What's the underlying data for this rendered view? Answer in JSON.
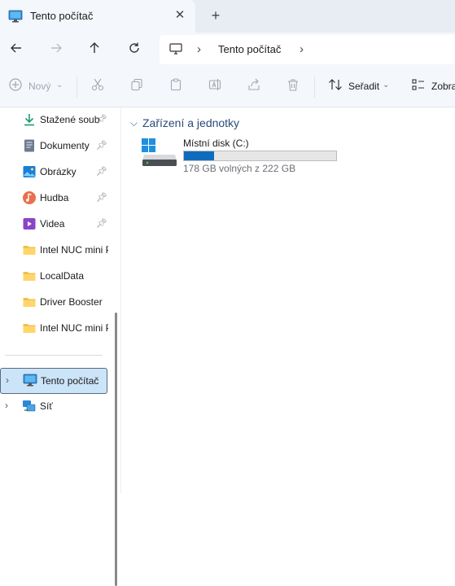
{
  "tab": {
    "title": "Tento počítač",
    "close_icon": "close-icon",
    "new_tab_icon": "plus-icon"
  },
  "address": {
    "crumb": "Tento počítač"
  },
  "toolbar": {
    "new_label": "Nový",
    "sort_label": "Seřadit",
    "view_label": "Zobra"
  },
  "sidebar": {
    "quick_access": [
      {
        "label": "Stažené soub",
        "icon": "download-icon",
        "pinned": true
      },
      {
        "label": "Dokumenty",
        "icon": "documents-icon",
        "pinned": true
      },
      {
        "label": "Obrázky",
        "icon": "pictures-icon",
        "pinned": true
      },
      {
        "label": "Hudba",
        "icon": "music-icon",
        "pinned": true
      },
      {
        "label": "Videa",
        "icon": "videos-icon",
        "pinned": true
      },
      {
        "label": "Intel NUC mini P",
        "icon": "folder-icon",
        "pinned": false
      },
      {
        "label": "LocalData",
        "icon": "folder-icon",
        "pinned": false
      },
      {
        "label": "Driver Booster",
        "icon": "folder-icon",
        "pinned": false
      },
      {
        "label": "Intel NUC mini P",
        "icon": "folder-icon",
        "pinned": false
      }
    ],
    "this_pc": "Tento počítač",
    "network": "Síť"
  },
  "main": {
    "group_title": "Zařízení a jednotky",
    "drive": {
      "name": "Místní disk (C:)",
      "size_text": "178 GB volných z 222 GB",
      "used_fraction": 0.198
    }
  },
  "colors": {
    "accent": "#0f6cbd",
    "selected_bg": "#cce4f7",
    "chrome": "#f4f7fb"
  }
}
